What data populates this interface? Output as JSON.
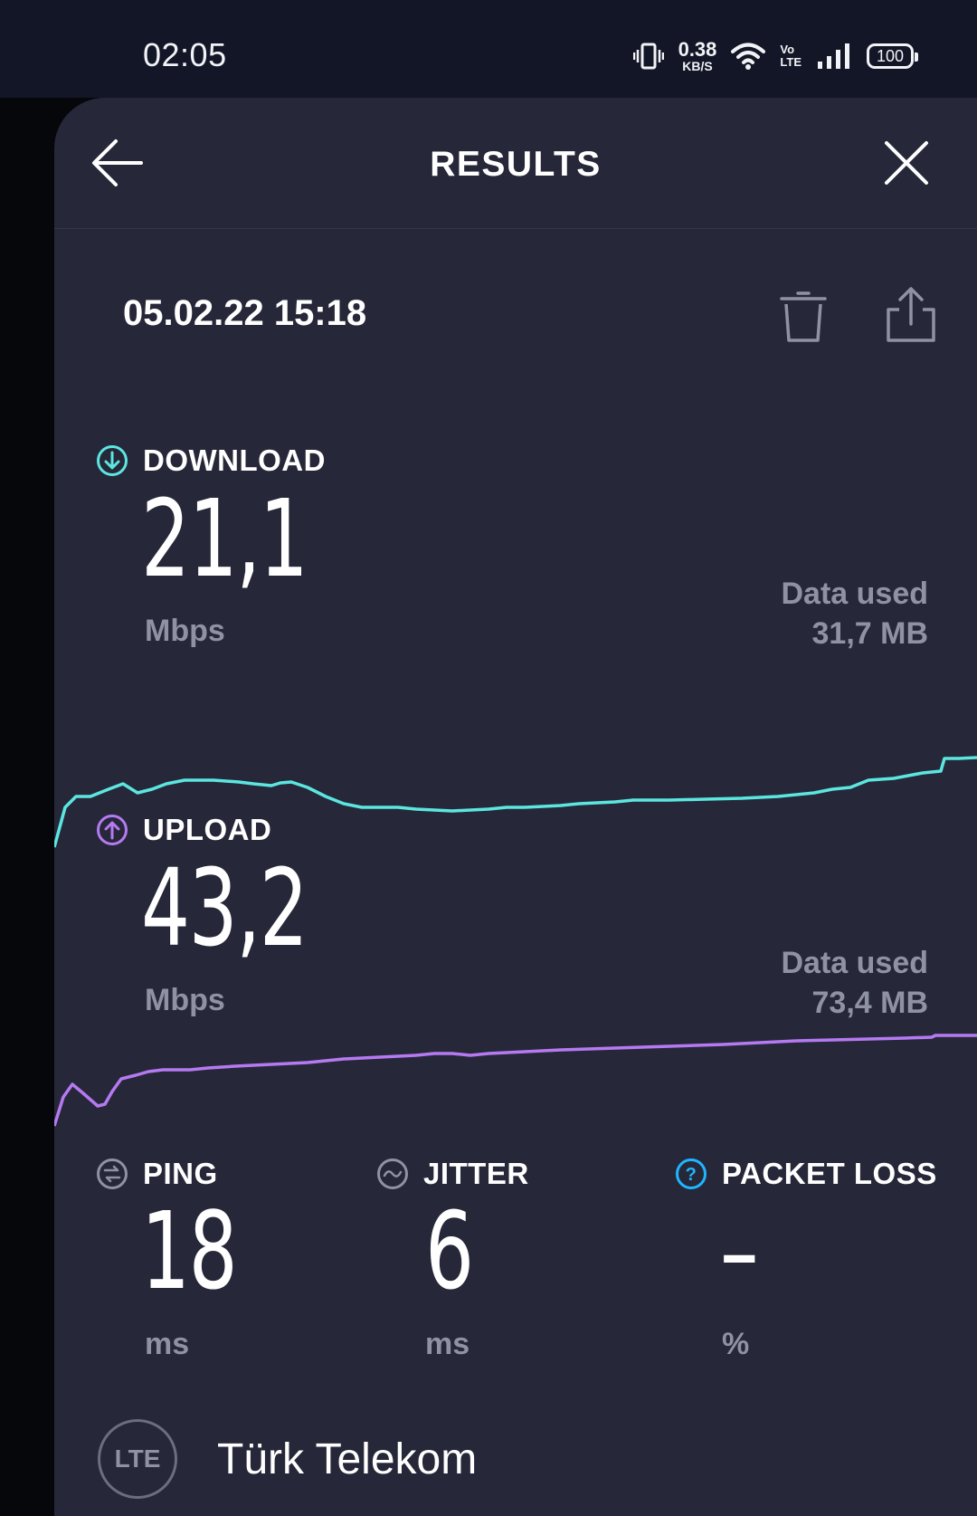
{
  "status_bar": {
    "time": "02:05",
    "net_speed_value": "0.38",
    "net_speed_unit": "KB/S",
    "volte_top": "Vo",
    "volte_bottom": "LTE",
    "battery": "100"
  },
  "header": {
    "title": "RESULTS",
    "back_icon": "arrow-left-icon",
    "close_icon": "close-icon"
  },
  "result": {
    "date": "05.02.22 15:18"
  },
  "download": {
    "label": "DOWNLOAD",
    "value": "21,1",
    "unit": "Mbps",
    "data_used_label": "Data used",
    "data_used_value": "31,7 MB",
    "color": "#5ce6e0"
  },
  "upload": {
    "label": "UPLOAD",
    "value": "43,2",
    "unit": "Mbps",
    "data_used_label": "Data used",
    "data_used_value": "73,4 MB",
    "color": "#b57af2"
  },
  "ping": {
    "label": "PING",
    "value": "18",
    "unit": "ms"
  },
  "jitter": {
    "label": "JITTER",
    "value": "6",
    "unit": "ms"
  },
  "packet_loss": {
    "label": "PACKET LOSS",
    "value": "–",
    "unit": "%",
    "color": "#1fb6ff"
  },
  "connection": {
    "type": "LTE",
    "provider": "Türk Telekom"
  }
}
